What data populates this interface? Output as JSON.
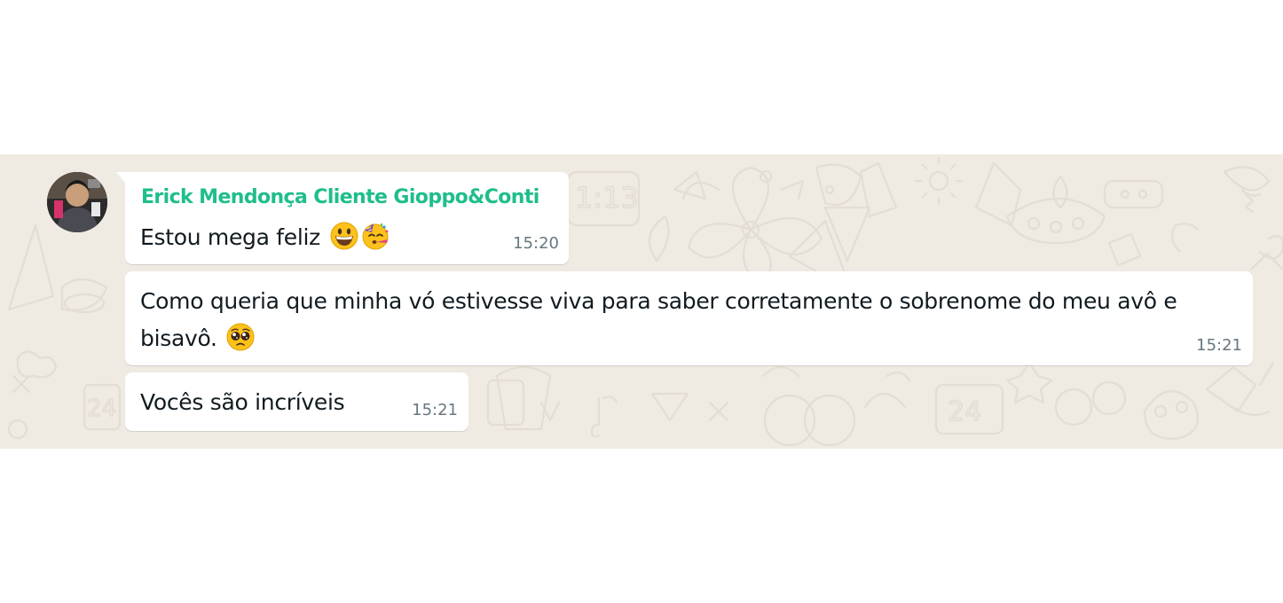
{
  "chat": {
    "background_color": "#efeae2",
    "bubble_color": "#ffffff",
    "sender_color": "#1fbe8c",
    "text_color": "#111b21",
    "time_color": "#667781"
  },
  "messages": [
    {
      "sender": "Erick Mendonça Cliente Gioppo&Conti",
      "text": "Estou mega feliz",
      "emojis": [
        "grinning-face-with-big-eyes-emoji",
        "partying-face-emoji"
      ],
      "time": "15:20"
    },
    {
      "text": "Como queria que minha vó estivesse viva para saber corretamente o sobrenome do meu avô e bisavô.",
      "emojis": [
        "pleading-face-emoji"
      ],
      "time": "15:21"
    },
    {
      "text": "Vocês são incríveis",
      "time": "15:21"
    }
  ]
}
